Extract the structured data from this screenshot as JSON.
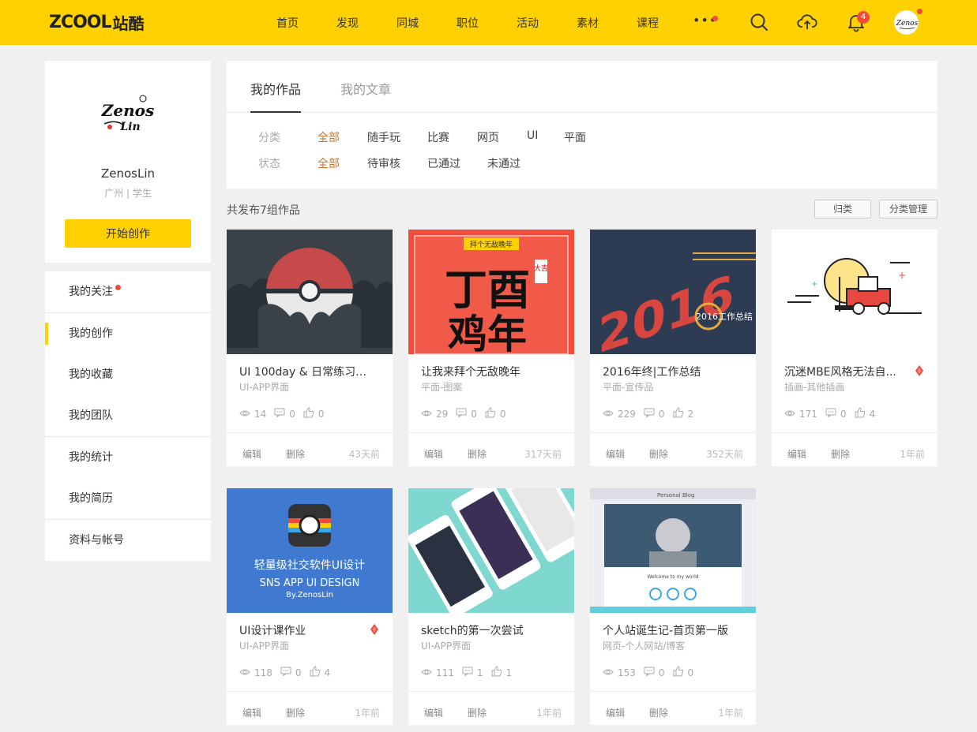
{
  "header": {
    "logo_mark": "ZCOOL",
    "logo_cn": "站酷",
    "nav": [
      "首页",
      "发现",
      "同城",
      "职位",
      "活动",
      "素材",
      "课程"
    ],
    "more_label": "•••",
    "notification_count": "4"
  },
  "profile": {
    "name": "ZenosLin",
    "location": "广州 | 学生",
    "create_button": "开始创作"
  },
  "menu": {
    "group1": [
      "我的关注",
      "我的创作",
      "我的收藏",
      "我的团队"
    ],
    "group2": [
      "我的统计",
      "我的简历"
    ],
    "group3": [
      "资料与帐号"
    ]
  },
  "tabs": {
    "works": "我的作品",
    "articles": "我的文章"
  },
  "filters": {
    "category_label": "分类",
    "category_options": [
      "全部",
      "随手玩",
      "比赛",
      "网页",
      "UI",
      "平面"
    ],
    "status_label": "状态",
    "status_options": [
      "全部",
      "待审核",
      "已通过",
      "未通过"
    ]
  },
  "summary": {
    "count_text": "共发布7组作品",
    "classify_button": "归类",
    "manage_button": "分类管理"
  },
  "actions": {
    "edit": "编辑",
    "delete": "删除"
  },
  "works": [
    {
      "title": "UI 100day & 日常练习整...",
      "category": "UI-APP界面",
      "views": "14",
      "comments": "0",
      "likes": "0",
      "time": "43天前",
      "recommended": false,
      "image": "pokeball"
    },
    {
      "title": "让我来拜个无敌晚年",
      "category": "平面-图案",
      "views": "29",
      "comments": "0",
      "likes": "0",
      "time": "317天前",
      "recommended": false,
      "image": "rooster"
    },
    {
      "title": "2016年终|工作总结",
      "category": "平面-宣传品",
      "views": "229",
      "comments": "0",
      "likes": "2",
      "time": "352天前",
      "recommended": false,
      "image": "y2016"
    },
    {
      "title": "沉迷MBE风格无法自...",
      "category": "插画-其他插画",
      "views": "171",
      "comments": "0",
      "likes": "4",
      "time": "1年前",
      "recommended": true,
      "image": "forklift"
    },
    {
      "title": "UI设计课作业",
      "category": "UI-APP界面",
      "views": "118",
      "comments": "0",
      "likes": "4",
      "time": "1年前",
      "recommended": true,
      "image": "sns"
    },
    {
      "title": "sketch的第一次尝试",
      "category": "UI-APP界面",
      "views": "111",
      "comments": "1",
      "likes": "1",
      "time": "1年前",
      "recommended": false,
      "image": "phones"
    },
    {
      "title": "个人站诞生记-首页第一版",
      "category": "网页-个人网站/博客",
      "views": "153",
      "comments": "0",
      "likes": "0",
      "time": "1年前",
      "recommended": false,
      "image": "blog"
    }
  ],
  "card_text": {
    "rooster_banner": "拜个无敌晚年",
    "rooster_big1": "丁酉",
    "rooster_big2": "鸡年",
    "rooster_side": "大吉",
    "y2016_big": "2016",
    "y2016_sub": "2016工作总结",
    "sns_cn": "轻量级社交软件UI设计",
    "sns_en": "SNS APP UI DESIGN",
    "sns_by": "By.ZenosLin",
    "blog_tab": "Personal Blog",
    "blog_welcome": "Welcome to my world"
  },
  "colors": {
    "brand_yellow": "#ffd100",
    "accent_red": "#f04b3b",
    "active_filter": "#d0702b"
  }
}
